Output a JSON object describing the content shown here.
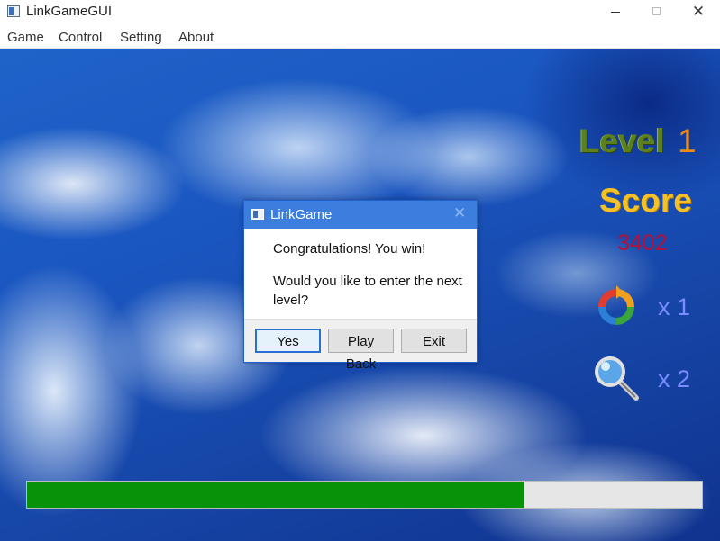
{
  "window": {
    "title": "LinkGameGUI"
  },
  "menu": {
    "items": [
      "Game",
      "Control",
      "Setting",
      "About"
    ]
  },
  "panel": {
    "level_label": "Level",
    "level_value": "1",
    "score_label": "Score",
    "score_value": "3402",
    "refresh_count": "x 1",
    "hint_count": "x 2"
  },
  "icons": {
    "refresh": "refresh-icon",
    "hint": "magnifier-icon"
  },
  "progress": {
    "fraction": 0.737,
    "fill_color": "#06930a"
  },
  "dialog": {
    "title": "LinkGame",
    "line1": "Congratulations! You win!",
    "line2": "Would you like to enter the next level?",
    "buttons": {
      "yes": "Yes",
      "play_back": "Play Back",
      "exit": "Exit"
    }
  },
  "colors": {
    "dialog_title_bar": "#3c7ede",
    "level_label": "#5c7f1f",
    "level_value": "#f08a12",
    "score_label": "#f3c128",
    "score_value": "#b2123a",
    "counts": "#7a8cff"
  }
}
